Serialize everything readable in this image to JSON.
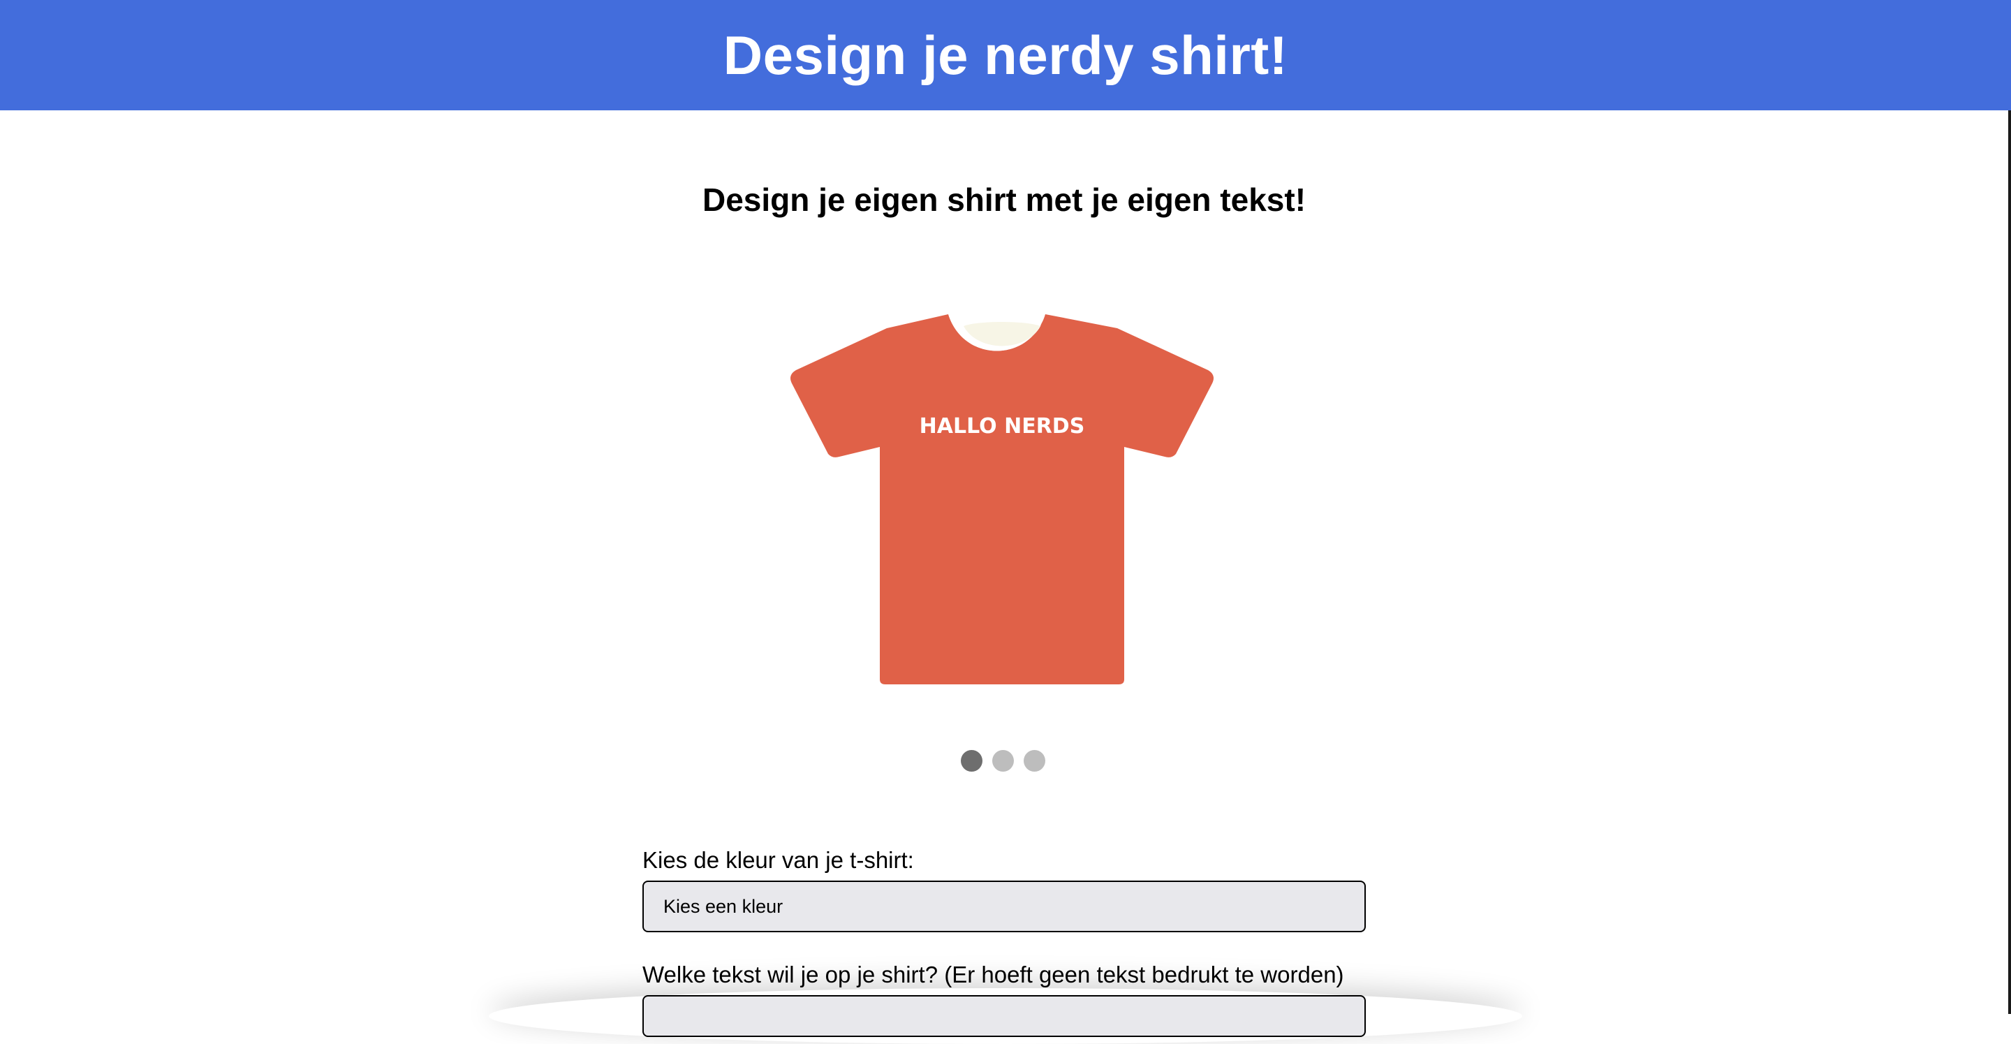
{
  "header": {
    "title": "Design je nerdy shirt!"
  },
  "intro": {
    "subtitle": "Design je eigen shirt met je eigen tekst!"
  },
  "preview": {
    "shirt_text": "HALLO NERDS",
    "shirt_color": "#e06148",
    "collar_color": "#f7f5e6",
    "text_color": "#ffffff"
  },
  "carousel": {
    "slide_count": 3,
    "active_index": 0
  },
  "form": {
    "color_label": "Kies de kleur van je t-shirt:",
    "color_select_value": "Kies een kleur",
    "text_label": "Welke tekst wil je op je shirt? (Er hoeft geen tekst bedrukt te worden)",
    "text_input_value": ""
  },
  "colors": {
    "header_bg": "#436ddc",
    "field_bg": "#e8e8ec",
    "dot_active": "#6e6e6e",
    "dot_inactive": "#bdbdbd"
  }
}
